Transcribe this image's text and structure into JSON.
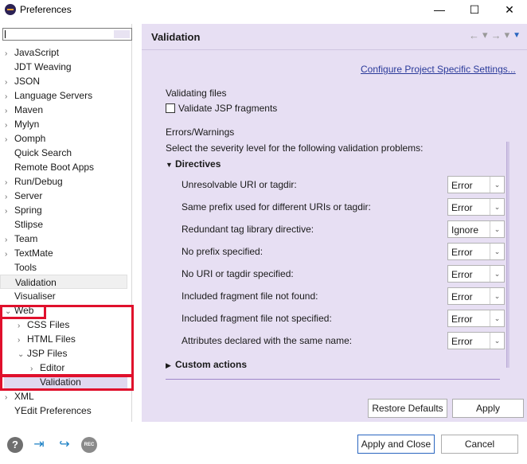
{
  "window": {
    "title": "Preferences",
    "minimize": "—",
    "maximize": "☐",
    "close": "✕"
  },
  "left": {
    "tree": [
      {
        "label": "JavaScript",
        "chev": "›",
        "indent": 0
      },
      {
        "label": "JDT Weaving",
        "chev": "",
        "indent": 0
      },
      {
        "label": "JSON",
        "chev": "›",
        "indent": 0
      },
      {
        "label": "Language Servers",
        "chev": "›",
        "indent": 0
      },
      {
        "label": "Maven",
        "chev": "›",
        "indent": 0
      },
      {
        "label": "Mylyn",
        "chev": "›",
        "indent": 0
      },
      {
        "label": "Oomph",
        "chev": "›",
        "indent": 0
      },
      {
        "label": "Quick Search",
        "chev": "",
        "indent": 0
      },
      {
        "label": "Remote Boot Apps",
        "chev": "",
        "indent": 0
      },
      {
        "label": "Run/Debug",
        "chev": "›",
        "indent": 0
      },
      {
        "label": "Server",
        "chev": "›",
        "indent": 0
      },
      {
        "label": "Spring",
        "chev": "›",
        "indent": 0
      },
      {
        "label": "Stlipse",
        "chev": "",
        "indent": 0
      },
      {
        "label": "Team",
        "chev": "›",
        "indent": 0
      },
      {
        "label": "TextMate",
        "chev": "›",
        "indent": 0
      },
      {
        "label": "Tools",
        "chev": "",
        "indent": 0
      },
      {
        "label": "Validation",
        "chev": "",
        "indent": 0,
        "state": "gray"
      },
      {
        "label": "Visualiser",
        "chev": "",
        "indent": 0
      },
      {
        "label": "Web",
        "chev": "⌄",
        "indent": 0
      },
      {
        "label": "CSS Files",
        "chev": "›",
        "indent": 1
      },
      {
        "label": "HTML Files",
        "chev": "›",
        "indent": 1
      },
      {
        "label": "JSP Files",
        "chev": "⌄",
        "indent": 1
      },
      {
        "label": "Editor",
        "chev": "›",
        "indent": 2
      },
      {
        "label": "Validation",
        "chev": "",
        "indent": 2,
        "state": "selected"
      },
      {
        "label": "XML",
        "chev": "›",
        "indent": 0
      },
      {
        "label": "YEdit Preferences",
        "chev": "",
        "indent": 0
      }
    ]
  },
  "main": {
    "title": "Validation",
    "nav": {
      "back": "←",
      "drop1": "▾",
      "forward": "→",
      "drop2": "▾",
      "menu": "▼"
    },
    "configure_link": "Configure Project Specific Settings...",
    "validating_files_title": "Validating files",
    "validate_jsp_label": "Validate JSP fragments",
    "validate_jsp_checked": false,
    "errors_title": "Errors/Warnings",
    "severity_desc": "Select the severity level for the following validation problems:",
    "directives_label": "Directives",
    "directives_expanded_icon": "▼",
    "rules": [
      {
        "label": "Unresolvable URI or tagdir:",
        "value": "Error"
      },
      {
        "label": "Same prefix used for different URIs or tagdir:",
        "value": "Error"
      },
      {
        "label": "Redundant tag library directive:",
        "value": "Ignore"
      },
      {
        "label": "No prefix specified:",
        "value": "Error"
      },
      {
        "label": "No URI or tagdir specified:",
        "value": "Error"
      },
      {
        "label": "Included fragment file not found:",
        "value": "Error"
      },
      {
        "label": "Included fragment file not specified:",
        "value": "Error"
      },
      {
        "label": "Attributes declared with the same name:",
        "value": "Error"
      }
    ],
    "custom_actions_label": "Custom actions",
    "custom_actions_icon": "▶",
    "restore_defaults": "Restore Defaults",
    "apply": "Apply"
  },
  "footer": {
    "help_icon": "?",
    "import_icon": "⇥",
    "export_icon": "↪",
    "rec_label": "REC",
    "apply_and_close": "Apply and Close",
    "cancel": "Cancel"
  },
  "colors": {
    "highlight_border": "#e0102c",
    "pane_bg": "#e7dff3",
    "link": "#2a3a9a",
    "accent": "#2a66c0"
  }
}
